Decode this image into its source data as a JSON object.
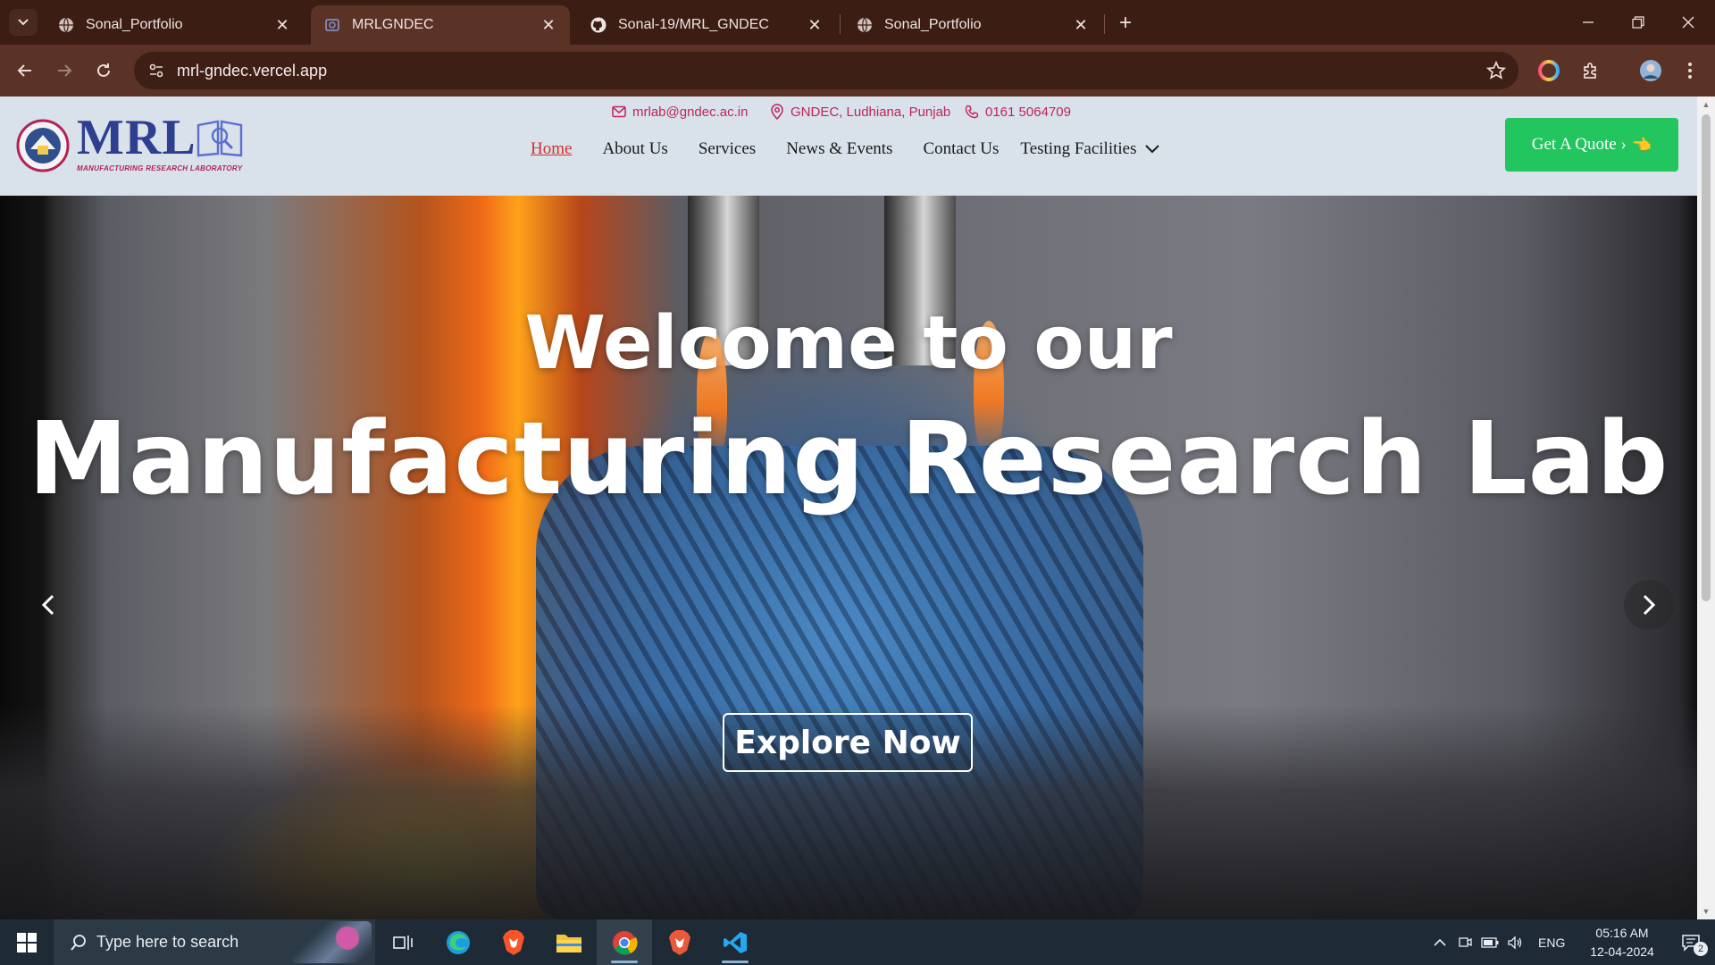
{
  "browser": {
    "tabs": [
      {
        "title": "Sonal_Portfolio",
        "favicon": "globe-icon",
        "active": false
      },
      {
        "title": "MRLGNDEC",
        "favicon": "mrl-favicon",
        "active": true
      },
      {
        "title": "Sonal-19/MRL_GNDEC",
        "favicon": "github-icon",
        "active": false
      },
      {
        "title": "Sonal_Portfolio",
        "favicon": "globe-icon",
        "active": false
      }
    ],
    "url": "mrl-gndec.vercel.app"
  },
  "site": {
    "logo": {
      "wordmark": "MRL",
      "tagline": "MANUFACTURING RESEARCH LABORATORY"
    },
    "contact": {
      "email": "mrlab@gndec.ac.in",
      "location": "GNDEC, Ludhiana, Punjab",
      "phone": "0161 5064709"
    },
    "nav": [
      {
        "label": "Home",
        "active": true
      },
      {
        "label": "About Us"
      },
      {
        "label": "Services"
      },
      {
        "label": "News & Events"
      },
      {
        "label": "Contact Us"
      },
      {
        "label": "Testing Facilities",
        "dropdown": true
      }
    ],
    "quote_button": "Get A Quote ›",
    "hero": {
      "line1": "Welcome to our",
      "line2": "Manufacturing Research Lab",
      "cta": "Explore Now"
    }
  },
  "taskbar": {
    "search_placeholder": "Type here to search",
    "apps": [
      "task-view-icon",
      "edge-icon",
      "brave-icon",
      "file-explorer-icon",
      "chrome-icon",
      "brave-icon",
      "vscode-icon"
    ],
    "language": "ENG",
    "time": "05:16 AM",
    "date": "12-04-2024",
    "notifications": "2"
  },
  "colors": {
    "tab_bar": "#3c1d14",
    "toolbar": "#5a3226",
    "header_bg": "#d9e1ea",
    "brand_blue": "#2f3f8f",
    "accent_red": "#c0245a",
    "quote_green": "#22c55e"
  }
}
